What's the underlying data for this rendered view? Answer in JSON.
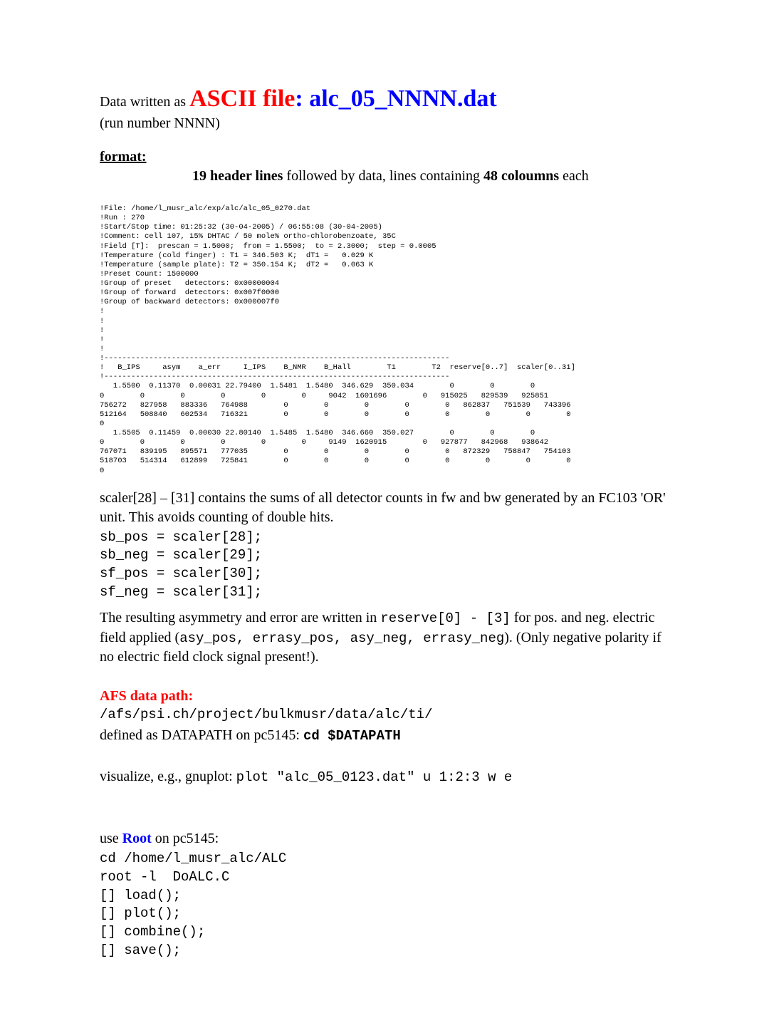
{
  "title": {
    "prefix": "Data written as ",
    "ascii": "ASCII file",
    "colon": ": ",
    "filename": "alc_05_NNNN.dat",
    "runline": "(run number NNNN)"
  },
  "format": {
    "heading": "format:",
    "sub_prefix": "",
    "sub_bold1": "19 header lines",
    "sub_mid": " followed by data, lines containing ",
    "sub_bold2": "48 coloumns",
    "sub_end": " each"
  },
  "data_sample": "!File: /home/l_musr_alc/exp/alc/alc_05_0270.dat\n!Run : 270\n!Start/Stop time: 01:25:32 (30-04-2005) / 06:55:08 (30-04-2005)\n!Comment: cell 107, 15% DHTAC / 50 mole% ortho-chlorobenzoate, 35C\n!Field [T]:  prescan = 1.5000;  from = 1.5500;  to = 2.3000;  step = 0.0005\n!Temperature (cold finger) : T1 = 346.503 K;  dT1 =   0.029 K\n!Temperature (sample plate): T2 = 350.154 K;  dT2 =   0.063 K\n!Preset Count: 1500000\n!Group of preset   detectors: 0x00000004\n!Group of forward  detectors: 0x007f0000\n!Group of backward detectors: 0x000007f0\n!\n!\n!\n!\n!\n!-----------------------------------------------------------------------------\n!   B_IPS     asym    a_err     I_IPS    B_NMR    B_Hall        T1        T2  reserve[0..7]  scaler[0..31]\n!-----------------------------------------------------------------------------\n   1.5500  0.11370  0.00031 22.79400  1.5481  1.5480  346.629  350.034        0        0        0\n0        0        0        0        0        0     9042  1601696        0   915025   829539   925851\n756272   827958   883336   764988        0        0        0        0        0   862837   751539   743396\n512164   508840   602534   716321        0        0        0        0        0        0        0        0\n0\n   1.5505  0.11459  0.00030 22.80140  1.5485  1.5480  346.660  350.027        0        0        0\n0        0        0        0        0        0     9149  1620915        0   927877   842968   938642\n767071   839195   895571   777035        0        0        0        0        0   872329   758847   754103\n518703   514314   612899   725841        0        0        0        0        0        0        0        0\n0",
  "scaler": {
    "para": "scaler[28] – [31] contains the sums of all detector counts in fw and bw generated by an FC103 'OR' unit. This avoids counting of double hits.",
    "code": "sb_pos = scaler[28];\nsb_neg = scaler[29];\nsf_pos = scaler[30];\nsf_neg = scaler[31];"
  },
  "asym": {
    "pre": "The resulting asymmetry and error are written in ",
    "code1": "reserve[0] - [3]",
    "mid1": " for pos. and neg. electric field applied (",
    "code2": "asy_pos, errasy_pos, asy_neg, errasy_neg",
    "end": "). (Only negative polarity if no electric field clock signal present!)."
  },
  "afs": {
    "heading": "AFS data path:",
    "path": "/afs/psi.ch/project/bulkmusr/data/alc/ti/",
    "defined_pre": "defined as DATAPATH on pc5145: ",
    "cd": "cd $DATAPATH"
  },
  "visualize": {
    "pre": "visualize, e.g., gnuplot: ",
    "cmd": "plot \"alc_05_0123.dat\" u 1:2:3 w e"
  },
  "root": {
    "pre": "use ",
    "root": "Root",
    "post": " on pc5145:",
    "code": "cd /home/l_musr_alc/ALC\nroot -l  DoALC.C\n[] load();\n[] plot();\n[] combine();\n[] save();"
  }
}
